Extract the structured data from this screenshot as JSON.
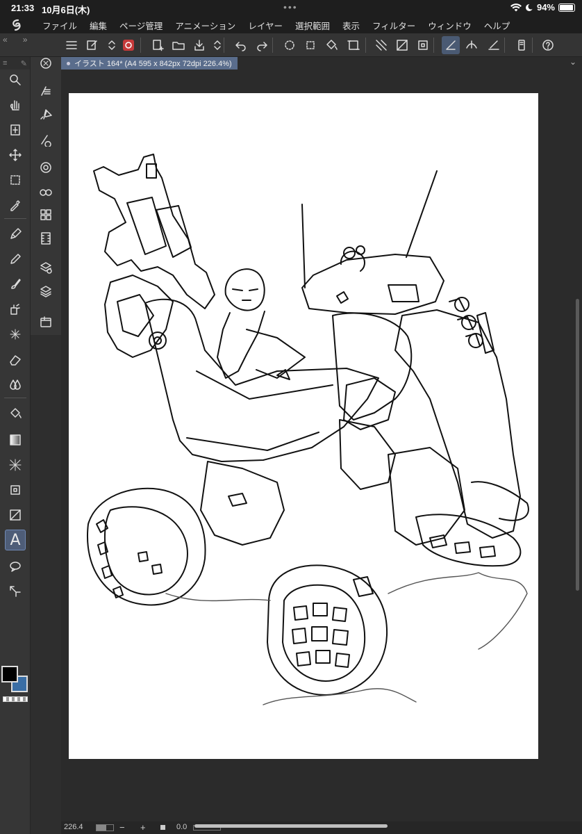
{
  "status_bar": {
    "time": "21:33",
    "date": "10月6日(木)",
    "battery": "94%",
    "battery_level": 0.94
  },
  "menu": {
    "items": [
      "ファイル",
      "編集",
      "ページ管理",
      "アニメーション",
      "レイヤー",
      "選択範囲",
      "表示",
      "フィルター",
      "ウィンドウ",
      "ヘルプ"
    ]
  },
  "toolbar": {
    "icons": [
      "menu-icon",
      "edit-icon",
      "up-down-icon",
      "clip-studio-icon",
      "new-page-icon",
      "open-folder-icon",
      "save-icon",
      "up-down-icon",
      "undo-icon",
      "redo-icon",
      "loading-icon",
      "transform-icon",
      "fill-icon",
      "select-icon",
      "grid-icon",
      "ruler-icon",
      "frame-icon",
      "snap-ruler-icon",
      "snap-special-icon",
      "snap-grid-icon",
      "device-icon",
      "help-icon"
    ],
    "active": [
      "snap-ruler-icon"
    ]
  },
  "document": {
    "tab_title": "イラスト 164* (A4 595 x 842px 72dpi 226.4%)"
  },
  "tools_primary": [
    "zoom-icon",
    "hand-icon",
    "layer-move-icon",
    "move-icon",
    "selection-icon",
    "eyedropper-icon",
    "pen-icon",
    "pencil-icon",
    "brush-icon",
    "airbrush-icon",
    "decoration-icon",
    "eraser-icon",
    "blend-icon",
    "fill-icon",
    "gradient-icon",
    "figure-icon",
    "frame-icon",
    "ruler-icon",
    "text-icon",
    "balloon-icon",
    "correct-line-icon"
  ],
  "tools_secondary": [
    "navigator-icon",
    "tool-property-icon",
    "sub-tool-icon",
    "brush-size-icon",
    "color-wheel-icon",
    "color-set-icon",
    "intermediate-color-icon",
    "animation-icon",
    "layer-property-icon",
    "layer-icon",
    "material-icon"
  ],
  "active_tool": "text-icon",
  "text_tool_glyph": "A",
  "colors": {
    "main": "#000000",
    "sub": "#3a6ea5"
  },
  "bottom": {
    "zoom": "226.4",
    "minus": "−",
    "plus": "+",
    "rotation": "0.0"
  }
}
